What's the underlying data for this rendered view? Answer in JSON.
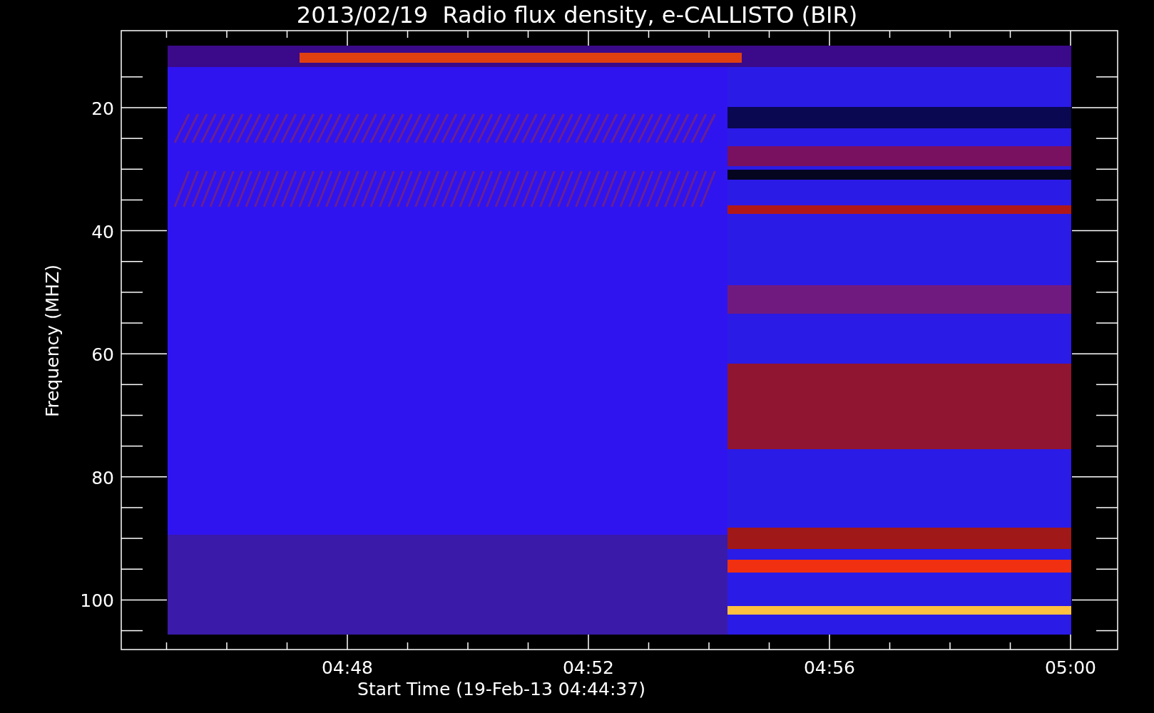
{
  "title": "2013/02/19  Radio flux density, e-CALLISTO (BIR)",
  "y_axis": {
    "label": "Frequency (MHZ)",
    "ticks": [
      "20",
      "40",
      "60",
      "80",
      "100"
    ]
  },
  "x_axis": {
    "label": "Start Time (19-Feb-13 04:44:37)",
    "ticks": [
      "04:48",
      "04:52",
      "04:56",
      "05:00"
    ]
  }
}
